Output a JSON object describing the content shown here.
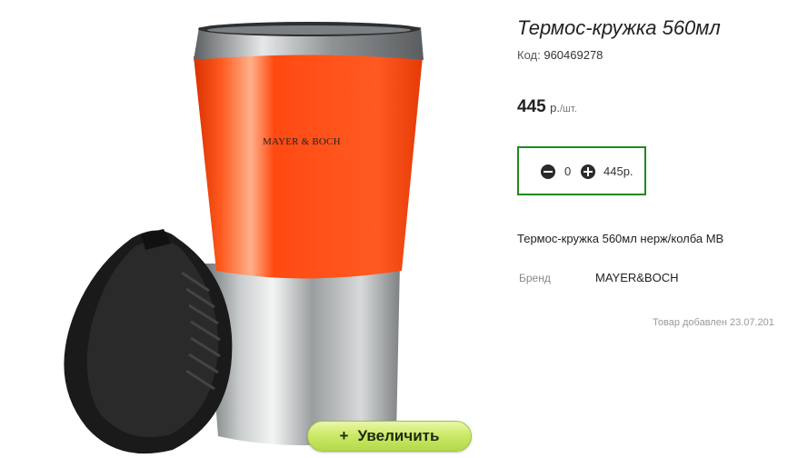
{
  "product": {
    "title": "Термос-кружка 560мл",
    "code_label": "Код:",
    "code_value": "960469278",
    "price_value": "445",
    "price_currency": "р.",
    "price_unit": "/шт.",
    "quantity": "0",
    "total": "445р.",
    "description": "Термос-кружка 560мл нерж/колба МВ",
    "brand_label": "Бренд",
    "brand_value": "MAYER&BOCH",
    "added_text": "Товар добавлен 23.07.201",
    "image_brand_print": "MAYER & BOCH"
  },
  "image": {
    "zoom_button_label": "Увеличить",
    "zoom_icon": "plus-icon"
  },
  "colors": {
    "accent_border": "#1e8a1e",
    "mug_orange": "#ff4a12",
    "zoom_button_green": "#c3e35c"
  }
}
